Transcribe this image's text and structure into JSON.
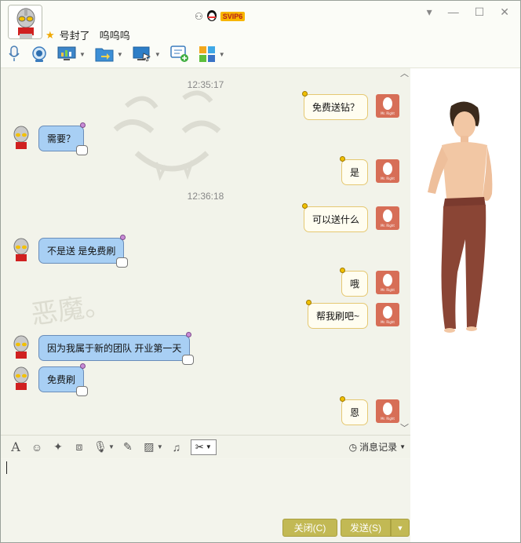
{
  "header": {
    "nickname": "号封了",
    "signature": "呜呜呜",
    "vip_label": "SVIP6",
    "controls": [
      "▾",
      "—",
      "☐",
      "✕"
    ]
  },
  "toolbar": {
    "icons": [
      "microphone-icon",
      "video-icon",
      "screen-share-icon",
      "file-transfer-icon",
      "remote-desktop-icon",
      "chat-plus-icon",
      "apps-icon"
    ]
  },
  "chat": {
    "watermark": "恶魔。",
    "messages": [
      {
        "type": "time",
        "text": "12:35:17"
      },
      {
        "type": "right",
        "text": "免费送钻？"
      },
      {
        "type": "left",
        "text": "需要？"
      },
      {
        "type": "right",
        "text": "是"
      },
      {
        "type": "time",
        "text": "12:36:18"
      },
      {
        "type": "right",
        "text": "可以送什么"
      },
      {
        "type": "left",
        "text": "不是送 是免费刷"
      },
      {
        "type": "right",
        "text": "哦"
      },
      {
        "type": "right",
        "text": "帮我刷吧~"
      },
      {
        "type": "left",
        "text": "因为我属于新的团队 开业第一天"
      },
      {
        "type": "left",
        "text": "免费刷"
      },
      {
        "type": "right",
        "text": "恩"
      }
    ]
  },
  "input_bar": {
    "history_label": "消息记录"
  },
  "buttons": {
    "close_label": "关闭(C)",
    "send_label": "发送(S)"
  },
  "colors": {
    "left_bubble": "#a8cff4",
    "right_bubble": "#fffdf0",
    "button": "#c2b954"
  }
}
